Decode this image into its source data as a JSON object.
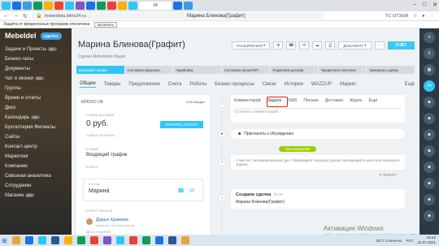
{
  "browser": {
    "tabs": [
      {
        "color": "#2fc6f6"
      },
      {
        "color": "#1a73e8"
      },
      {
        "color": "#3b9de0"
      },
      {
        "color": "#0f9d58"
      },
      {
        "color": "#f4b400"
      },
      {
        "color": "#ea4335"
      },
      {
        "color": "#2fc6f6"
      },
      {
        "color": "#7e57c2"
      },
      {
        "color": "#1a73e8"
      },
      {
        "color": "#0f9d58"
      },
      {
        "color": "#ea4335"
      },
      {
        "color": "#f4b400"
      },
      {
        "color": "#2fc6f6"
      },
      {
        "color": "#1a73e8"
      },
      {
        "color": "#3b9de0"
      }
    ],
    "active_tab_label": "24",
    "url": "mebeldela.bitrix24.ru",
    "page_title": "Марина Блинова(Графит)",
    "right_label": "ТС ОТЗЫВ",
    "infobar_text": "Защита от вредоносных программ отключена",
    "infobar_button": "Включить"
  },
  "sidebar": {
    "logo": "Mebeldel",
    "logo_button": "СДЕЛКА",
    "items": [
      {
        "label": "Задачи и Проекты",
        "count": "99+"
      },
      {
        "label": "Бизнес-чаты",
        "count": ""
      },
      {
        "label": "Документы",
        "count": ""
      },
      {
        "label": "Чат и звонки",
        "count": "99+"
      },
      {
        "label": "Группы",
        "count": ""
      },
      {
        "label": "Время и отчеты",
        "count": ""
      },
      {
        "label": "Диск",
        "count": ""
      },
      {
        "label": "Календарь",
        "count": "99+"
      },
      {
        "label": "Бухгалтерия Филиалы",
        "count": ""
      },
      {
        "label": "Сайты",
        "count": ""
      },
      {
        "label": "Контакт-центр",
        "count": ""
      },
      {
        "label": "Маркетинг",
        "count": ""
      },
      {
        "label": "Компании",
        "count": ""
      },
      {
        "label": "Сквозная аналитика",
        "count": ""
      },
      {
        "label": "Сотрудники",
        "count": ""
      },
      {
        "label": "Магазин",
        "count": "99+"
      }
    ]
  },
  "header": {
    "title": "Марина Блинова(Графит)",
    "subtitle": "Сделки Mebeldela общие",
    "extensions_button": "РАСШИРЕНИЯ",
    "document_button": "ДОКУМЕНТ",
    "invoice_button": "СЧЁТ"
  },
  "stages": [
    "Входящий трафик",
    "Составили визуализ...",
    "Чарабойка",
    "Составили проект/КП...",
    "Подписали договор",
    "Предоплата получена",
    "Завершить сделку"
  ],
  "tabs": [
    "Общие",
    "Товары",
    "Предложения",
    "Счета",
    "Роботы",
    "Бизнес-процессы",
    "Связи",
    "История",
    "WAZZUP",
    "Маркет",
    "Ещё"
  ],
  "card": {
    "heading": "КРАТКО ОБ",
    "heading_right": "БОК мандат",
    "sum_label": "Сумма договора",
    "sum_value": "0 руб.",
    "pay_button": "ПРИНЯТЬ ОПЛАТУ",
    "paid_label": "Сумма оплачено",
    "paid_value": "",
    "stage_label": "Стадия",
    "stage_value": "Входящий трафик",
    "client_label": "Клиент",
    "contact_small": "Контакт",
    "contact_name": "Марина",
    "responsible_label": "Ответственный",
    "responsible_name": "Дарья Храмова",
    "responsible_role": "Директор сети филиалов",
    "created_label": "Дата создания"
  },
  "composer": {
    "tabs": [
      "Комментарий",
      "Задача",
      "SMS",
      "Письмо",
      "Доставка",
      "Ждать",
      "Ещё"
    ],
    "active_tab": "Задача",
    "placeholder": "Оставить комментарий"
  },
  "timeline": {
    "invite_text": "Пригласить к обсуждению",
    "planned_badge": "Запланировано",
    "notice_text": "У вас нет запланированных дел. Переведите текущую сделку запланируйте дела или назначьте задачи.",
    "filter_label": "ФИЛЬТР",
    "done_title": "Создана сделка",
    "done_time": "16:38",
    "done_desc": "Марина Блинова(Графит)"
  },
  "right_bar": {
    "counter": "24"
  },
  "watermark": {
    "title": "Активация Windows",
    "subtitle": "Чтобы активировать Windows, перейдите в раздел \"Параметры\"."
  },
  "taskbar": {
    "apps": [
      {
        "color": "#e8a33d"
      },
      {
        "color": "#1a73e8"
      },
      {
        "color": "#2fc6f6"
      },
      {
        "color": "#2b5797"
      },
      {
        "color": "#f4b400"
      },
      {
        "color": "#0f9d58"
      },
      {
        "color": "#ea4335"
      },
      {
        "color": "#7e57c2"
      },
      {
        "color": "#2fc6f6"
      },
      {
        "color": "#ea4335"
      },
      {
        "color": "#0f9d58"
      },
      {
        "color": "#1a73e8"
      },
      {
        "color": "#2b5797"
      },
      {
        "color": "#e8a33d"
      }
    ],
    "weather": "26°C Солнечно",
    "language": "РУС",
    "time": "16:42",
    "date": "24.07.2021"
  }
}
